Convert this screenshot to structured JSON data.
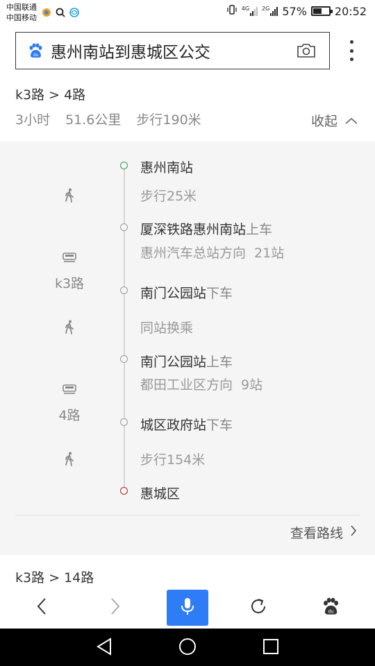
{
  "status_bar": {
    "carrier1": "中国联通",
    "carrier2": "中国移动",
    "net1": "4G",
    "net2": "2G",
    "battery_percent": "57%",
    "battery_level": 0.57,
    "time": "20:52"
  },
  "search": {
    "query": "惠州南站到惠城区公交",
    "logo_icon": "baidu-paw-icon",
    "camera_icon": "camera-icon",
    "more_icon": "more-vertical-icon"
  },
  "route": {
    "title": "k3路 > 4路",
    "duration": "3小时",
    "distance": "51.6公里",
    "walk": "步行190米",
    "collapse_label": "收起"
  },
  "steps": {
    "start": "惠州南站",
    "walk1": "步行25米",
    "board1_station": "厦深铁路惠州南站",
    "board1_action": "上车",
    "board1_direction": "惠州汽车总站方向",
    "board1_count": "21站",
    "line1": "k3路",
    "alight1_station": "南门公园站",
    "alight1_action": "下车",
    "transfer": "同站换乘",
    "board2_station": "南门公园站",
    "board2_action": "上车",
    "board2_direction": "都田工业区方向",
    "board2_count": "9站",
    "line2": "4路",
    "alight2_station": "城区政府站",
    "alight2_action": "下车",
    "walk2": "步行154米",
    "end": "惠城区"
  },
  "view_route_label": "查看路线",
  "next_route_title": "k3路 > 14路",
  "colors": {
    "accent": "#2e7cf6",
    "start_dot": "#2a9d5c",
    "end_dot": "#b22222",
    "panel_bg": "#f5f5f5"
  }
}
